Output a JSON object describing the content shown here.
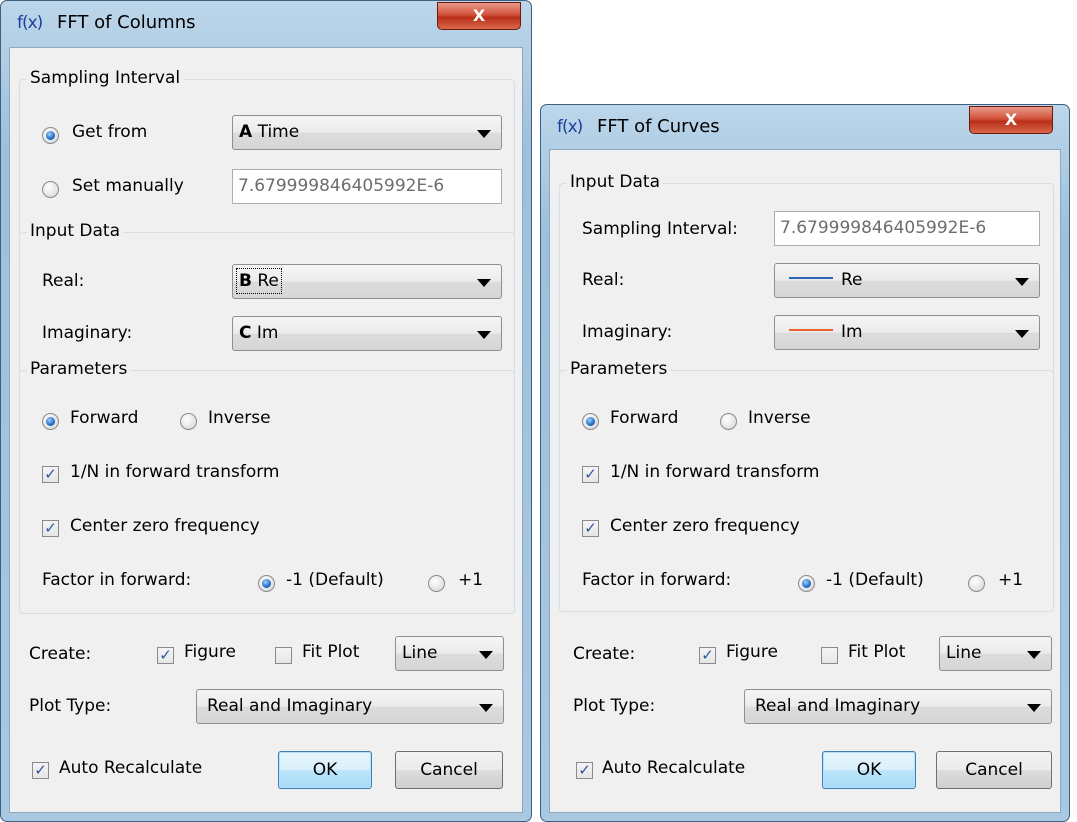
{
  "dialog1": {
    "icon": "f(x)",
    "title": "FFT of Columns",
    "close": "X",
    "sampling": {
      "group_title": "Sampling Interval",
      "get_from_label": "Get from",
      "get_from_col": "A",
      "get_from_name": "Time",
      "set_manually_label": "Set manually",
      "set_manually_value": "7.679999846405992E-6"
    },
    "input": {
      "group_title": "Input Data",
      "real_label": "Real:",
      "real_col": "B",
      "real_name": "Re",
      "imag_label": "Imaginary:",
      "imag_col": "C",
      "imag_name": "Im"
    },
    "params": {
      "group_title": "Parameters",
      "forward": "Forward",
      "inverse": "Inverse",
      "one_over_n": "1/N in forward transform",
      "center_zero": "Center zero frequency",
      "factor_label": "Factor in forward:",
      "factor_default": "-1 (Default)",
      "factor_plus": "+1"
    },
    "create_label": "Create:",
    "figure": "Figure",
    "fit_plot": "Fit Plot",
    "line_option": "Line",
    "plot_type_label": "Plot Type:",
    "plot_type_value": "Real and Imaginary",
    "auto_recalc": "Auto Recalculate",
    "ok": "OK",
    "cancel": "Cancel"
  },
  "dialog2": {
    "icon": "f(x)",
    "title": "FFT of Curves",
    "close": "X",
    "input": {
      "group_title": "Input Data",
      "sampling_label": "Sampling Interval:",
      "sampling_value": "7.679999846405992E-6",
      "real_label": "Real:",
      "real_curve": "Re",
      "real_color": "#2f63b8",
      "imag_label": "Imaginary:",
      "imag_curve": "Im",
      "imag_color": "#e8632f"
    },
    "params": {
      "group_title": "Parameters",
      "forward": "Forward",
      "inverse": "Inverse",
      "one_over_n": "1/N in forward transform",
      "center_zero": "Center zero frequency",
      "factor_label": "Factor in forward:",
      "factor_default": "-1 (Default)",
      "factor_plus": "+1"
    },
    "create_label": "Create:",
    "figure": "Figure",
    "fit_plot": "Fit Plot",
    "line_option": "Line",
    "plot_type_label": "Plot Type:",
    "plot_type_value": "Real and Imaginary",
    "auto_recalc": "Auto Recalculate",
    "ok": "OK",
    "cancel": "Cancel"
  },
  "icons": {
    "checkmark": "✓",
    "fx": "fx-icon",
    "close": "close-icon"
  }
}
